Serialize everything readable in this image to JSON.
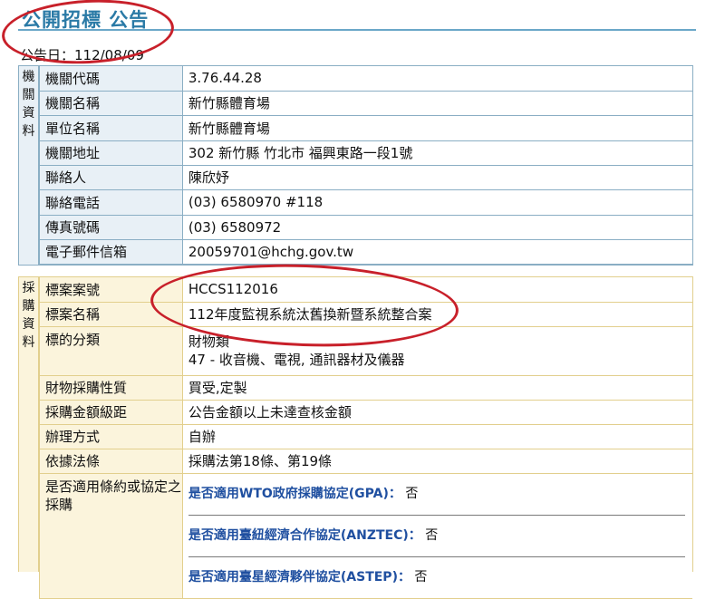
{
  "header": {
    "title": "公開招標 公告",
    "pub_date_label": "公告日：112/08/09"
  },
  "agency": {
    "side_label": "機關資料",
    "rows": [
      {
        "key": "機關代碼",
        "value": "3.76.44.28"
      },
      {
        "key": "機關名稱",
        "value": "新竹縣體育場"
      },
      {
        "key": "單位名稱",
        "value": "新竹縣體育場"
      },
      {
        "key": "機關地址",
        "value": "302 新竹縣 竹北市 福興東路一段1號"
      },
      {
        "key": "聯絡人",
        "value": "陳欣妤"
      },
      {
        "key": "聯絡電話",
        "value": "(03) 6580970 #118"
      },
      {
        "key": "傳真號碼",
        "value": "(03) 6580972"
      },
      {
        "key": "電子郵件信箱",
        "value": "20059701@hchg.gov.tw"
      }
    ]
  },
  "procurement": {
    "side_label": "採購資料",
    "case_no": {
      "key": "標案案號",
      "value": "HCCS112016"
    },
    "case_name": {
      "key": "標案名稱",
      "value": "112年度監視系統汰舊換新暨系統整合案"
    },
    "category": {
      "key": "標的分類",
      "line1": "財物類",
      "line2": "47 - 收音機、電視, 通訊器材及儀器"
    },
    "nature": {
      "key": "財物採購性質",
      "value": "買受,定製"
    },
    "amount_level": {
      "key": "採購金額級距",
      "value": "公告金額以上未達查核金額"
    },
    "method": {
      "key": "辦理方式",
      "value": "自辦"
    },
    "legal_basis": {
      "key": "依據法條",
      "value": "採購法第18條、第19條"
    },
    "agreements": {
      "key": "是否適用條約或協定之採購",
      "items": [
        {
          "question": "是否適用WTO政府採購協定(GPA)：",
          "answer": "否"
        },
        {
          "question": "是否適用臺紐經濟合作協定(ANZTEC)：",
          "answer": "否"
        },
        {
          "question": "是否適用臺星經濟夥伴協定(ASTEP)：",
          "answer": "否"
        }
      ]
    }
  },
  "colors": {
    "title": "#2a7aa6",
    "annotation_circle": "#c8202a",
    "agency_border": "#8aaec4",
    "procurement_border": "#e2cf8d",
    "agreement_question": "#1f4fa0"
  }
}
